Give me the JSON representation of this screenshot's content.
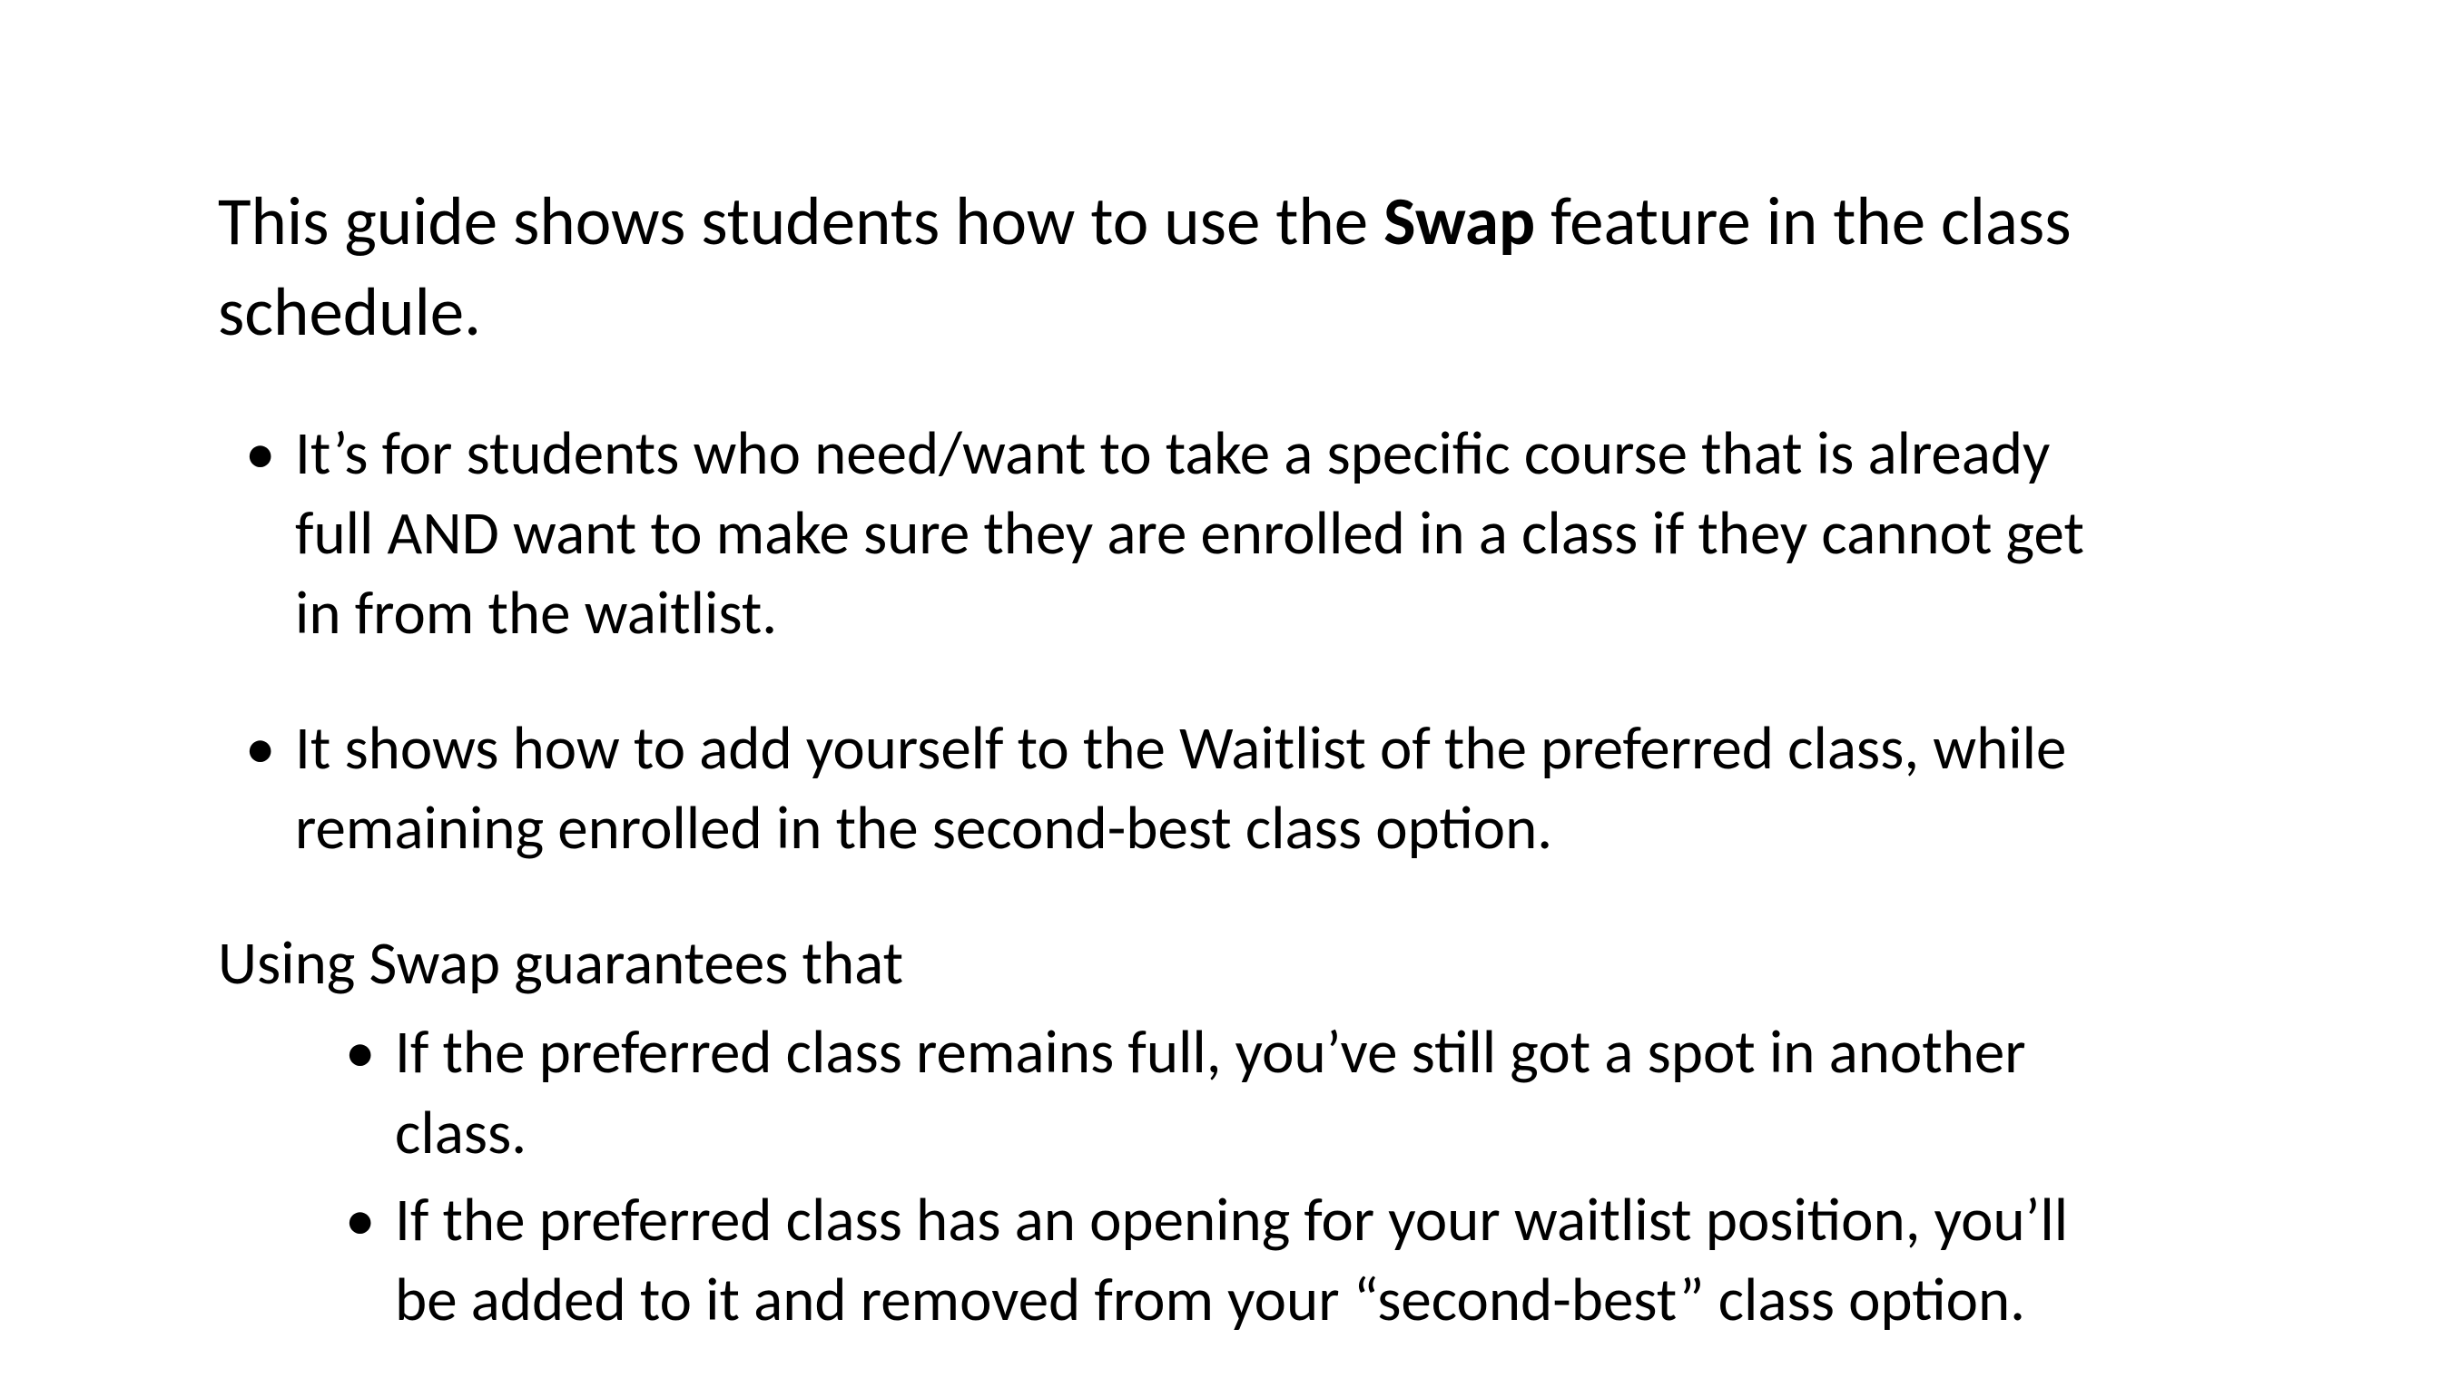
{
  "intro": {
    "prefix": "This guide shows students how to use the ",
    "bold": "Swap",
    "suffix": " feature in the class schedule."
  },
  "bullets_primary": [
    "It’s for students who need/want to take a specific course that is already full AND want to make sure they are enrolled in a class if they cannot get in from the waitlist.",
    "It shows how to add yourself to the Waitlist of the preferred class, while remaining enrolled in the second-best class option."
  ],
  "subhead": "Using Swap guarantees that",
  "bullets_secondary": [
    "If the preferred class remains full, you’ve still got a spot in another class.",
    "If the preferred class has an opening for your waitlist position, you’ll be added to it and removed from your “second-best” class option."
  ]
}
